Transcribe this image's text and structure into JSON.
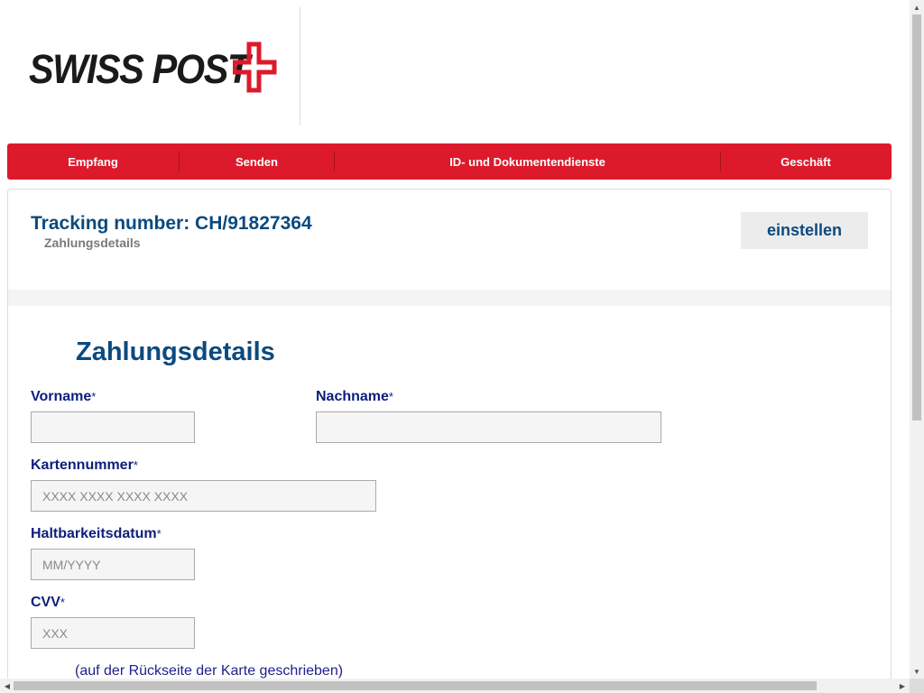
{
  "header": {
    "logo_text": "SWISS POST",
    "brand_color": "#dc1a2b"
  },
  "nav": {
    "items": [
      {
        "label": "Empfang"
      },
      {
        "label": "Senden"
      },
      {
        "label": "ID- und Dokumentendienste"
      },
      {
        "label": "Geschäft"
      }
    ]
  },
  "tracking": {
    "title": "Tracking number: CH/91827364",
    "subtitle": "Zahlungsdetails",
    "button_label": "einstellen"
  },
  "form": {
    "title": "Zahlungsdetails",
    "required_mark": "*",
    "first_name": {
      "label": "Vorname",
      "value": "",
      "placeholder": ""
    },
    "last_name": {
      "label": "Nachname",
      "value": "",
      "placeholder": ""
    },
    "card_number": {
      "label": "Kartennummer",
      "value": "",
      "placeholder": "XXXX XXXX XXXX XXXX"
    },
    "expiry": {
      "label": "Haltbarkeitsdatum",
      "value": "",
      "placeholder": "MM/YYYY"
    },
    "cvv": {
      "label": "CVV",
      "value": "",
      "placeholder": "XXX"
    },
    "cvv_hint": "(auf der Rückseite der Karte geschrieben)"
  },
  "icons": {
    "swiss_cross": "swiss-cross-icon",
    "scroll_up": "arrow-up-icon",
    "scroll_down": "arrow-down-icon",
    "scroll_left": "arrow-left-icon",
    "scroll_right": "arrow-right-icon"
  }
}
